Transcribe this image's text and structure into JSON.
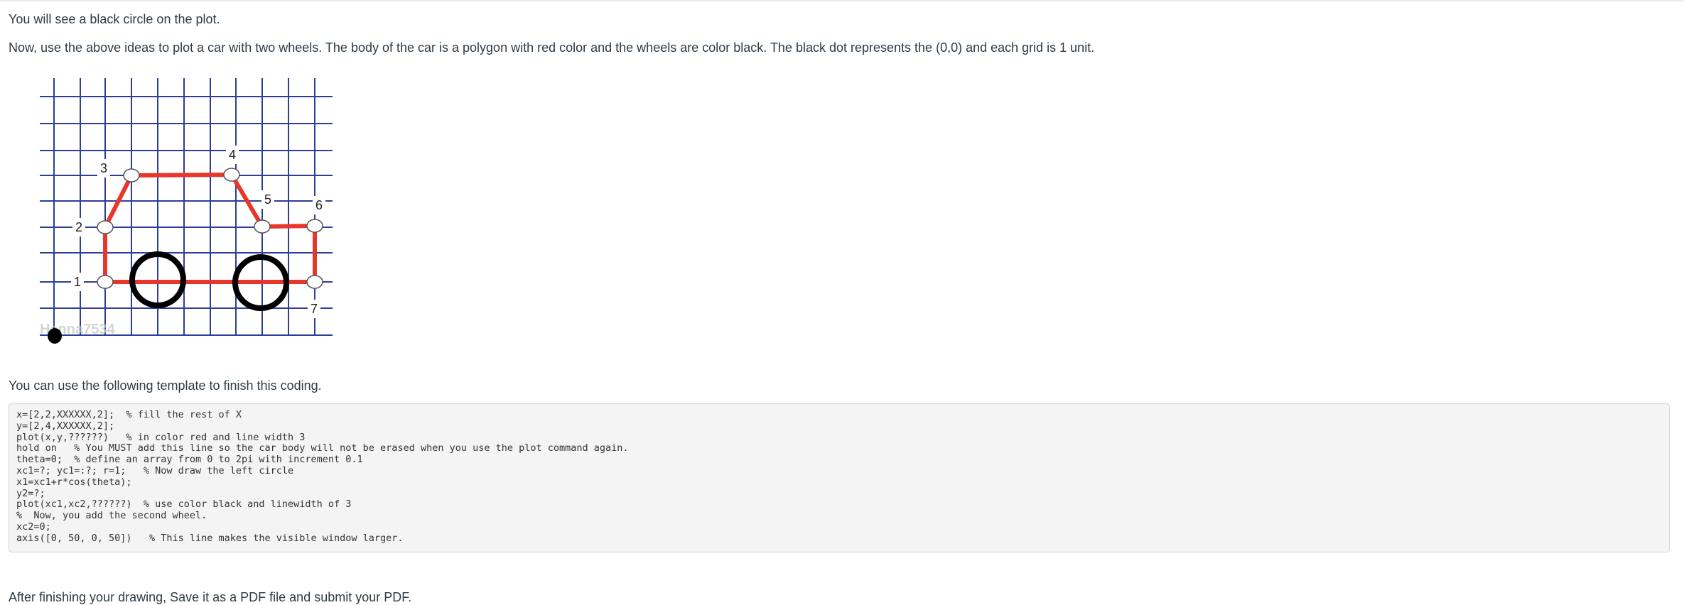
{
  "instructions": {
    "line1": "You will see a black circle on the plot.",
    "line2": "Now, use the above ideas to plot a car with two wheels. The body of the car is a polygon with red color and the wheels are color black. The black dot represents the (0,0) and each grid is 1 unit.",
    "template_intro": "You can use the following template to finish this coding.",
    "footer": "After finishing your drawing, Save it as a PDF file and submit your PDF."
  },
  "figure": {
    "point_labels": [
      "1",
      "2",
      "3",
      "4",
      "5",
      "6",
      "7"
    ],
    "watermark": "Hanna7534",
    "colors": {
      "grid": "#2b3f9a",
      "body": "#e8362a",
      "wheel": "#000000",
      "origin": "#000000"
    }
  },
  "code_template": [
    {
      "code": "x=[2,2,XXXXXX,2];",
      "comment": "  % fill the rest of X"
    },
    {
      "code": "y=[2,4,XXXXXX,2];",
      "comment": ""
    },
    {
      "code": "plot(x,y,??????)",
      "comment": "   % in color red and line width 3"
    },
    {
      "code": "hold on",
      "comment": "   % You MUST add this line so the car body will not be erased when you use the plot command again."
    },
    {
      "code": "theta=0;",
      "comment": "  % define an array from 0 to 2pi with increment 0.1"
    },
    {
      "code": "xc1=?; yc1=:?; r=1;",
      "comment": "   % Now draw the left circle"
    },
    {
      "code": "x1=xc1+r*cos(theta);",
      "comment": ""
    },
    {
      "code": "y2=?;",
      "comment": ""
    },
    {
      "code": "plot(xc1,xc2,??????)",
      "comment": "  % use color black and linewidth of 3"
    },
    {
      "code": "%  Now, you add the second wheel.",
      "comment": ""
    },
    {
      "code": "xc2=0;",
      "comment": ""
    },
    {
      "code": "axis([0, 50, 0, 50])",
      "comment": "   % This line makes the visible window larger."
    }
  ]
}
